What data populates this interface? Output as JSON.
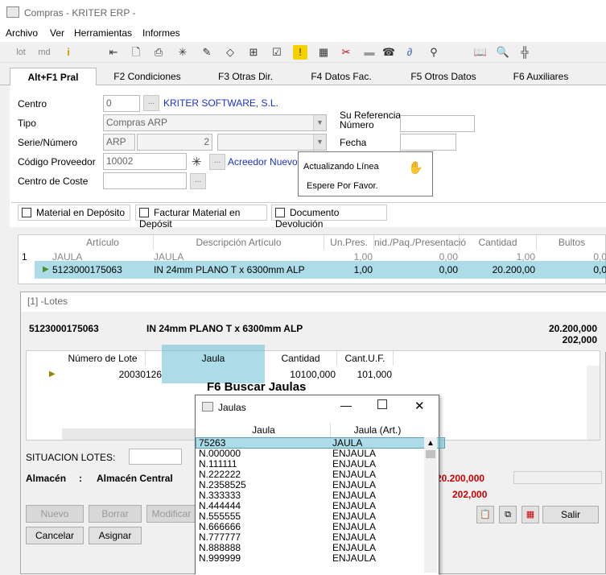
{
  "window": {
    "title": "Compras - KRITER ERP -"
  },
  "menu": [
    "Archivo",
    "Ver",
    "Herramientas",
    "Informes"
  ],
  "toolbar": {
    "lot": "lot",
    "md": "md"
  },
  "tabs": [
    "Alt+F1 Pral",
    "F2 Condiciones",
    "F3 Otras Dir.",
    "F4 Datos Fac.",
    "F5 Otros Datos",
    "F6 Auxiliares"
  ],
  "form": {
    "centro_label": "Centro",
    "centro_value": "0",
    "centro_name": "KRITER SOFTWARE, S.L.",
    "tipo_label": "Tipo",
    "tipo_value": "Compras ARP",
    "serie_label": "Serie/Número",
    "serie_value": "ARP",
    "numero_value": "2",
    "proveedor_label": "Código Proveedor",
    "proveedor_value": "10002",
    "proveedor_name": "Acreedor Nuevo S",
    "coste_label": "Centro de Coste",
    "su_referencia_label": "Su Referencia",
    "numero_label": "Número",
    "fecha_label": "Fecha",
    "chk_material": "Material en Depósito",
    "chk_facturar": "Facturar Material en Depósit",
    "chk_devolucion": "Documento Devolución"
  },
  "popup": {
    "line1": "Actualizando Línea",
    "line2": "Espere Por Favor."
  },
  "grid": {
    "headers": [
      "Artículo",
      "Descripción Artículo",
      "Un.Pres.",
      "nid./Paq./Presentació",
      "Cantidad",
      "Bultos"
    ],
    "row_num": "1",
    "row1": [
      "JAULA",
      "JAULA",
      "1,00",
      "0,00",
      "1,00",
      "0,0"
    ],
    "row2": [
      "5123000175063",
      "IN 24mm PLANO T x 6300mm ALP",
      "1,00",
      "0,00",
      "20.200,00",
      "0,0"
    ]
  },
  "lotes": {
    "title": "[1] -Lotes",
    "article": "5123000175063",
    "description": "IN 24mm PLANO T x 6300mm ALP",
    "total1": "20.200,000",
    "total2": "202,000",
    "headers": [
      "Número de Lote",
      "Jaula",
      "Cantidad",
      "Cant.U.F."
    ],
    "row": [
      "20030126",
      "",
      "10100,000",
      "101,000"
    ],
    "hint": "F6 Buscar Jaulas",
    "situacion_label": "SITUACION LOTES:",
    "almacen_label": "Almacén",
    "almacen_sep": ":",
    "almacen_value": "Almacén Central",
    "sum1": "20.200,000",
    "sum2": "202,000",
    "buttons": {
      "nuevo": "Nuevo",
      "borrar": "Borrar",
      "modificar": "Modificar",
      "cancelar": "Cancelar",
      "asignar": "Asignar",
      "salir": "Salir"
    }
  },
  "jaulas": {
    "title": "Jaulas",
    "headers": [
      "Jaula",
      "Jaula (Art.)"
    ],
    "rows": [
      [
        "75263",
        "JAULA"
      ],
      [
        "N.000000",
        "ENJAULA"
      ],
      [
        "N.111111",
        "ENJAULA"
      ],
      [
        "N.222222",
        "ENJAULA"
      ],
      [
        "N.2358525",
        "ENJAULA"
      ],
      [
        "N.333333",
        "ENJAULA"
      ],
      [
        "N.444444",
        "ENJAULA"
      ],
      [
        "N.555555",
        "ENJAULA"
      ],
      [
        "N.666666",
        "ENJAULA"
      ],
      [
        "N.777777",
        "ENJAULA"
      ],
      [
        "N.888888",
        "ENJAULA"
      ],
      [
        "N.999999",
        "ENJAULA"
      ]
    ]
  },
  "colors": {
    "highlight": "#66c0d6",
    "link": "#1a31c9",
    "red": "#cc0000"
  }
}
